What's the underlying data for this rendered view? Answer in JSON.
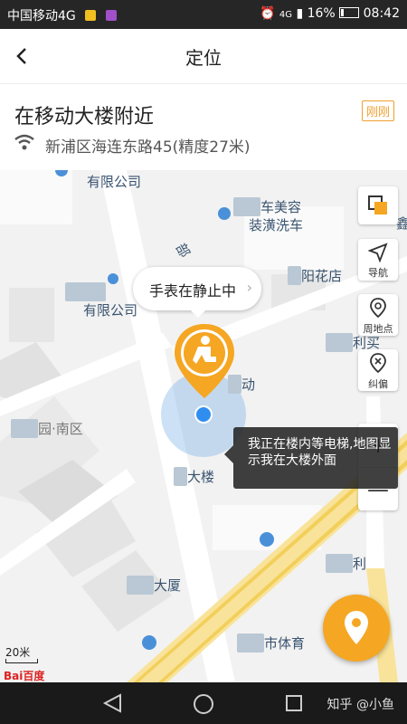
{
  "status_bar": {
    "carrier": "中国移动4G",
    "battery_percent": "16%",
    "time": "08:42",
    "signal_label": "4G"
  },
  "header": {
    "title": "定位",
    "back_icon": "chevron-left-icon"
  },
  "location": {
    "name": "在移动大楼附近",
    "badge": "刚刚",
    "address": "新浦区海连东路45(精度27米)"
  },
  "map": {
    "labels": {
      "company_top": "有限公司",
      "car_wash_a": "车美容",
      "car_wash_b": "装潢洗车",
      "flower": "阳花店",
      "company_mid": "有限公司",
      "mid_right": "动",
      "park": "园·南区",
      "building": "大楼",
      "mansion": "大厦",
      "sports": "市体育",
      "road": "部",
      "far_right_1": "鑫",
      "far_right_2": "利",
      "far_right_3": "利买"
    },
    "tools": {
      "navigate": "导航",
      "places": "周地点",
      "correct": "纠偏"
    },
    "bubble_text": "手表在静止中",
    "note": "我正在楼内等电梯,地图显示我在大楼外面",
    "scale": "20米",
    "logo": "Bai百度"
  },
  "watermark": "知乎 @小鱼",
  "colors": {
    "accent": "#f5a623",
    "location_blue": "#2f8ef0",
    "map_bg": "#f2f2f2"
  }
}
